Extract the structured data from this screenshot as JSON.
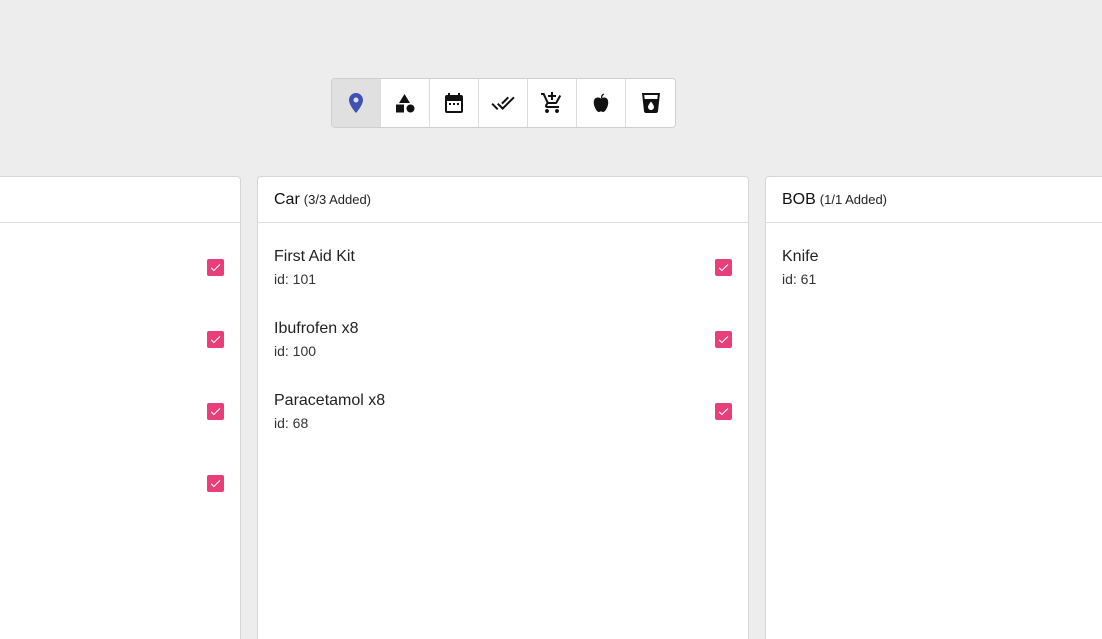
{
  "toolbar": {
    "buttons": [
      {
        "icon": "location-pin-icon",
        "active": true
      },
      {
        "icon": "shapes-icon",
        "active": false
      },
      {
        "icon": "calendar-icon",
        "active": false
      },
      {
        "icon": "done-all-icon",
        "active": false
      },
      {
        "icon": "add-cart-icon",
        "active": false
      },
      {
        "icon": "apple-icon",
        "active": false
      },
      {
        "icon": "water-glass-icon",
        "active": false
      }
    ],
    "accent_color": "#3f51b5"
  },
  "columns": [
    {
      "title": "",
      "count": "",
      "items": [
        {
          "name": "",
          "id": "",
          "checked": true
        },
        {
          "name": "",
          "id": "",
          "checked": true
        },
        {
          "name": "",
          "id": "",
          "checked": true
        },
        {
          "name": "",
          "id": "",
          "checked": true
        }
      ]
    },
    {
      "title": "Car",
      "count": "(3/3 Added)",
      "items": [
        {
          "name": "First Aid Kit",
          "id": "id: 101",
          "checked": true
        },
        {
          "name": "Ibufrofen x8",
          "id": "id: 100",
          "checked": true
        },
        {
          "name": "Paracetamol x8",
          "id": "id: 68",
          "checked": true
        }
      ]
    },
    {
      "title": "BOB",
      "count": "(1/1 Added)",
      "items": [
        {
          "name": "Knife",
          "id": "id: 61",
          "checked": false
        }
      ]
    }
  ],
  "checkbox_color": "#e83e7a"
}
